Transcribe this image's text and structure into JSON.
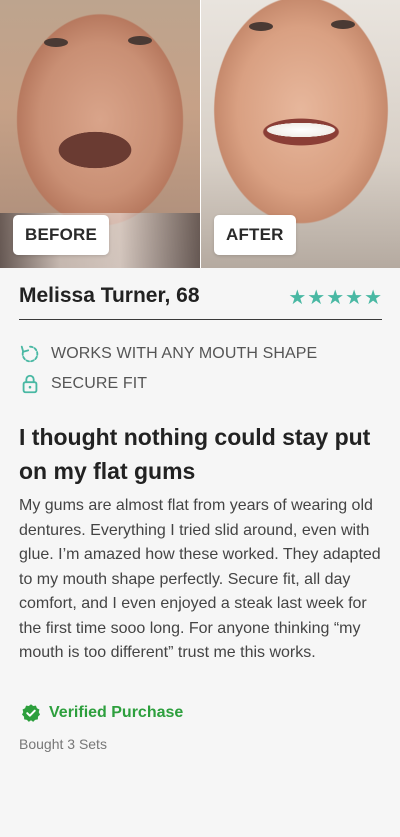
{
  "photos": {
    "before_label": "BEFORE",
    "after_label": "AFTER"
  },
  "review": {
    "name": "Melissa Turner, 68",
    "rating": 5,
    "stars": [
      "★",
      "★",
      "★",
      "★",
      "★"
    ],
    "features": [
      {
        "label": "WORKS WITH ANY MOUTH SHAPE",
        "icon": "refresh-icon"
      },
      {
        "label": "SECURE FIT",
        "icon": "lock-icon"
      }
    ],
    "headline": "I thought nothing could stay put on my flat gums",
    "body": "My gums are almost flat from years of wearing old dentures. Everything I tried slid around, even with glue. I’m amazed how these worked. They adapted to my mouth shape perfectly. Secure fit, all day comfort, and I even enjoyed a steak last week for the first time sooo long. For anyone thinking “my mouth is too different” trust me this works.",
    "verified_label": "Verified Purchase",
    "bought_label": "Bought 3 Sets"
  },
  "colors": {
    "star": "#49b8a3",
    "verified": "#2d9f3d",
    "icon": "#49b8a3"
  }
}
